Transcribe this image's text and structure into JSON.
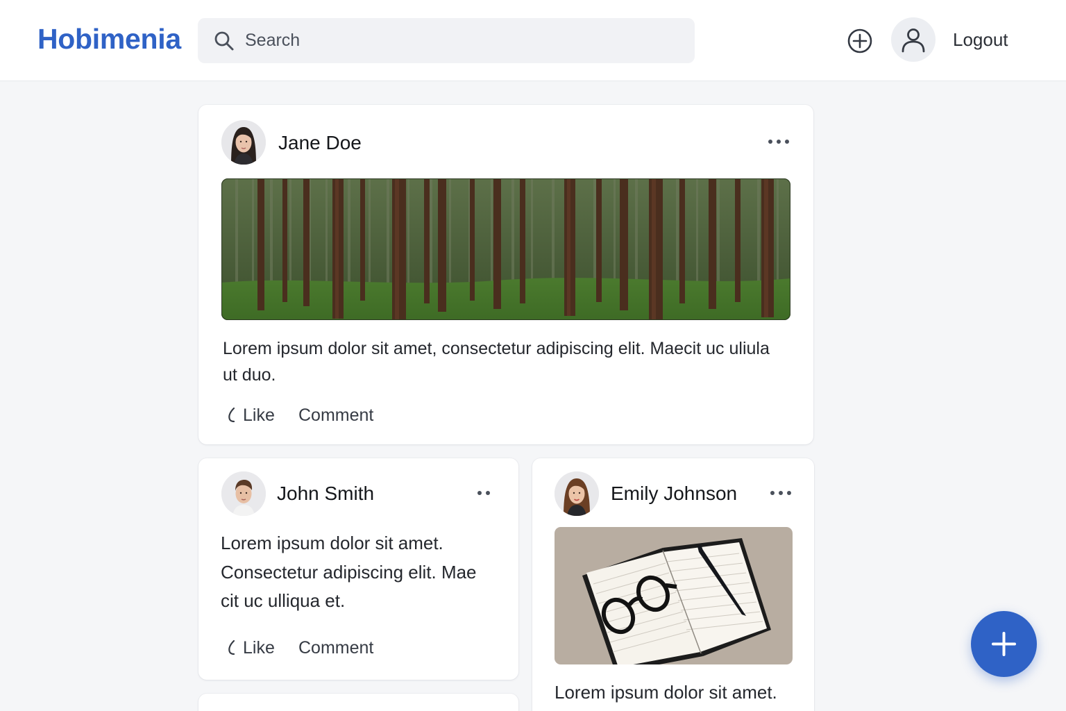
{
  "header": {
    "logo": "Hobimenia",
    "search_placeholder": "Search",
    "logout_label": "Logout"
  },
  "icons": {
    "search": "search-icon",
    "add_post": "plus-circle-icon",
    "profile": "user-icon",
    "more": "more-horizontal-icon",
    "like": "like-icon",
    "fab": "plus-icon"
  },
  "colors": {
    "brand": "#2f62c6",
    "background": "#f5f6f8",
    "card": "#ffffff"
  },
  "posts": [
    {
      "author": "Jane Doe",
      "text": "Lorem ipsum dolor sit amet, consectetur adipiscing elit. Maecit uc uliula ut duo.",
      "like_label": "Like",
      "comment_label": "Comment",
      "image": "forest-image"
    },
    {
      "author": "John Smith",
      "text": "Lorem ipsum dolor sit amet. Consectetur adipiscing elit. Mae cit uc ulliqua et.",
      "like_label": "Like",
      "comment_label": "Comment"
    },
    {
      "author": "Emily Johnson",
      "text": "Lorem ipsum dolor sit amet.",
      "image": "notebook-image"
    }
  ]
}
